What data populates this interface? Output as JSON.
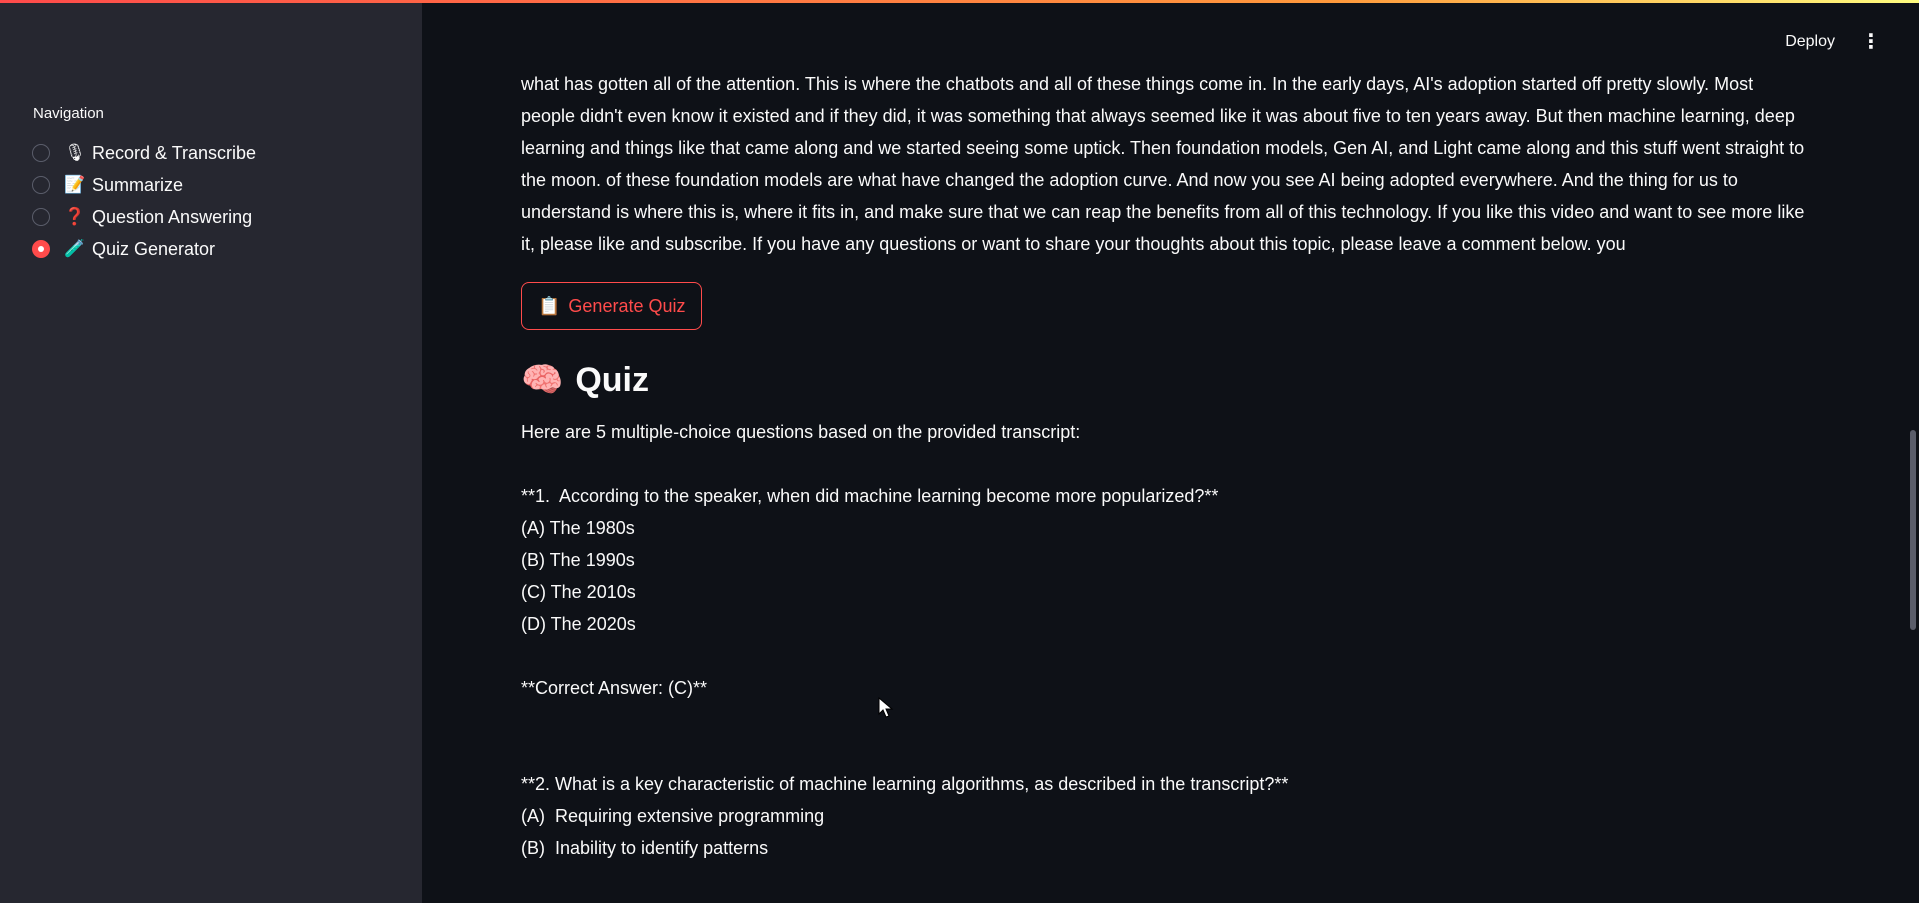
{
  "sidebar": {
    "nav_title": "Navigation",
    "items": [
      {
        "emoji": "🎙",
        "label": "Record & Transcribe",
        "selected": false
      },
      {
        "emoji": "📝",
        "label": "Summarize",
        "selected": false
      },
      {
        "emoji": "❓",
        "label": "Question Answering",
        "selected": false
      },
      {
        "emoji": "🧪",
        "label": "Quiz Generator",
        "selected": true
      }
    ]
  },
  "header": {
    "deploy_label": "Deploy",
    "menu_icon": "⋮"
  },
  "main": {
    "transcript": "what has gotten all of the attention. This is where the chatbots and all of these things come in. In the early days, AI's adoption started off pretty slowly. Most people didn't even know it existed and if they did, it was something that always seemed like it was about five to ten years away. But then machine learning, deep learning and things like that came along and we started seeing some uptick. Then foundation models, Gen AI, and Light came along and this stuff went straight to the moon. of these foundation models are what have changed the adoption curve. And now you see AI being adopted everywhere. And the thing for us to understand is where this is, where it fits in, and make sure that we can reap the benefits from all of this technology. If you like this video and want to see more like it, please like and subscribe. If you have any questions or want to share your thoughts about this topic, please leave a comment below. you",
    "generate_button": {
      "emoji": "📋",
      "label": "Generate Quiz"
    },
    "quiz_heading": {
      "emoji": "🧠",
      "text": "Quiz"
    },
    "quiz": {
      "intro": "Here are 5 multiple-choice questions based on the provided transcript:",
      "q1": {
        "question": "**1.  According to the speaker, when did machine learning become more popularized?**",
        "options": [
          "(A) The 1980s",
          "(B) The 1990s",
          "(C) The 2010s",
          "(D) The 2020s"
        ],
        "answer": "**Correct Answer: (C)**"
      },
      "q2": {
        "question": "**2. What is a key characteristic of machine learning algorithms, as described in the transcript?**",
        "options": [
          "(A)  Requiring extensive programming",
          "(B)  Inability to identify patterns"
        ]
      }
    }
  }
}
